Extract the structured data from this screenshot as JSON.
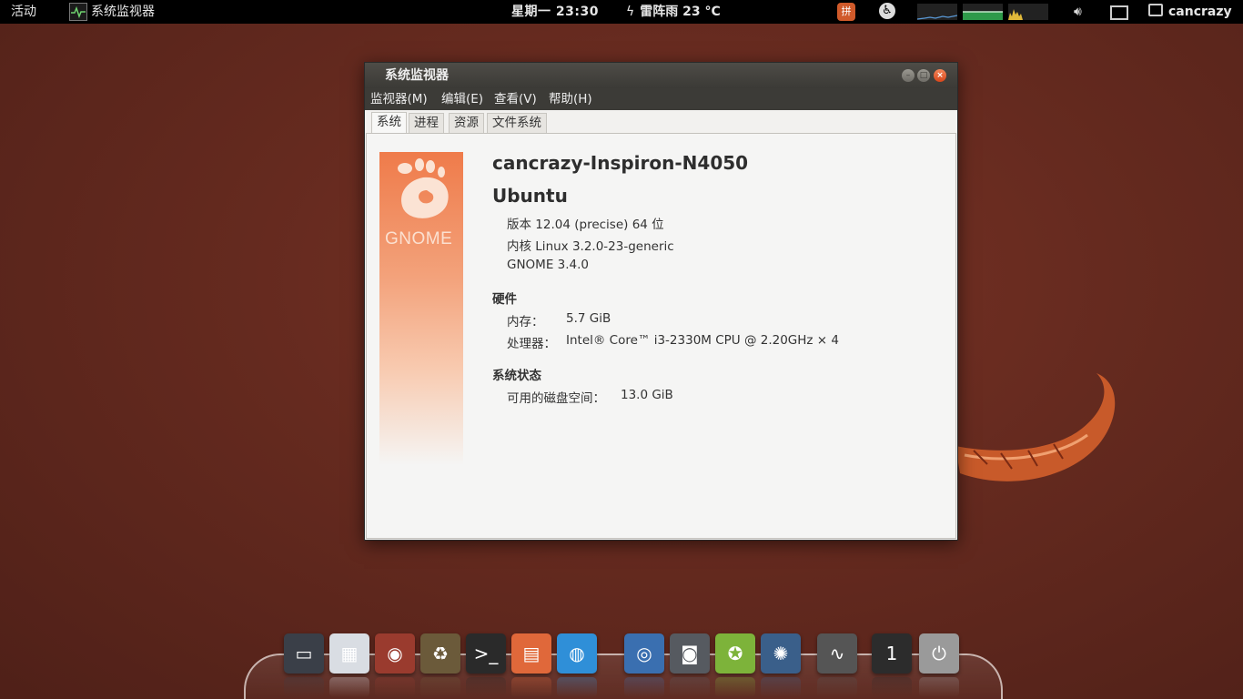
{
  "top_panel": {
    "activities": "活动",
    "app_name": "系统监视器",
    "clock": "星期一 23:30",
    "weather": "雷阵雨 23 °C",
    "user": "cancrazy"
  },
  "window": {
    "title": "系统监视器",
    "menu": [
      "监视器(M)",
      "编辑(E)",
      "查看(V)",
      "帮助(H)"
    ],
    "tabs": [
      "系统",
      "进程",
      "资源",
      "文件系统"
    ],
    "active_tab": "系统"
  },
  "system": {
    "logo_text": "GNOME",
    "hostname": "cancrazy-Inspiron-N4050",
    "os_name": "Ubuntu",
    "version": "版本 12.04 (precise) 64 位",
    "kernel": "内核 Linux 3.2.0-23-generic",
    "gnome": "GNOME 3.4.0",
    "hardware_heading": "硬件",
    "memory_label": "内存：",
    "memory_value": "5.7 GiB",
    "cpu_label": "处理器：",
    "cpu_value": "Intel® Core™ i3-2330M CPU @ 2.20GHz × 4",
    "status_heading": "系统状态",
    "disk_label": "可用的磁盘空间：",
    "disk_value": "13.0 GiB"
  },
  "dock": {
    "items": [
      {
        "name": "desktop",
        "color": "#3a3f48",
        "glyph": "▭"
      },
      {
        "name": "calendar",
        "color": "#d9dde3",
        "glyph": "▦"
      },
      {
        "name": "ubuntu-tweak",
        "color": "#9a3b2e",
        "glyph": "◉"
      },
      {
        "name": "archive-manager",
        "color": "#6b5a3a",
        "glyph": "♻"
      },
      {
        "name": "terminal",
        "color": "#2a2a2a",
        "glyph": ">_"
      },
      {
        "name": "software-center",
        "color": "#e0683a",
        "glyph": "▤"
      },
      {
        "name": "browser",
        "color": "#2f8fd8",
        "glyph": "◍"
      },
      {
        "name": "chromium",
        "color": "#3a6fb0",
        "glyph": "◎"
      },
      {
        "name": "speakers",
        "color": "#565a60",
        "glyph": "◙"
      },
      {
        "name": "ubuntu-one",
        "color": "#7db33a",
        "glyph": "✪"
      },
      {
        "name": "aperture",
        "color": "#3a5f8a",
        "glyph": "✺"
      },
      {
        "name": "system-monitor",
        "color": "#555",
        "glyph": "∿"
      },
      {
        "name": "workspace",
        "color": "#2c2c2c",
        "glyph": "1"
      },
      {
        "name": "power",
        "color": "#9a9a9a",
        "glyph": "⏻"
      }
    ]
  }
}
